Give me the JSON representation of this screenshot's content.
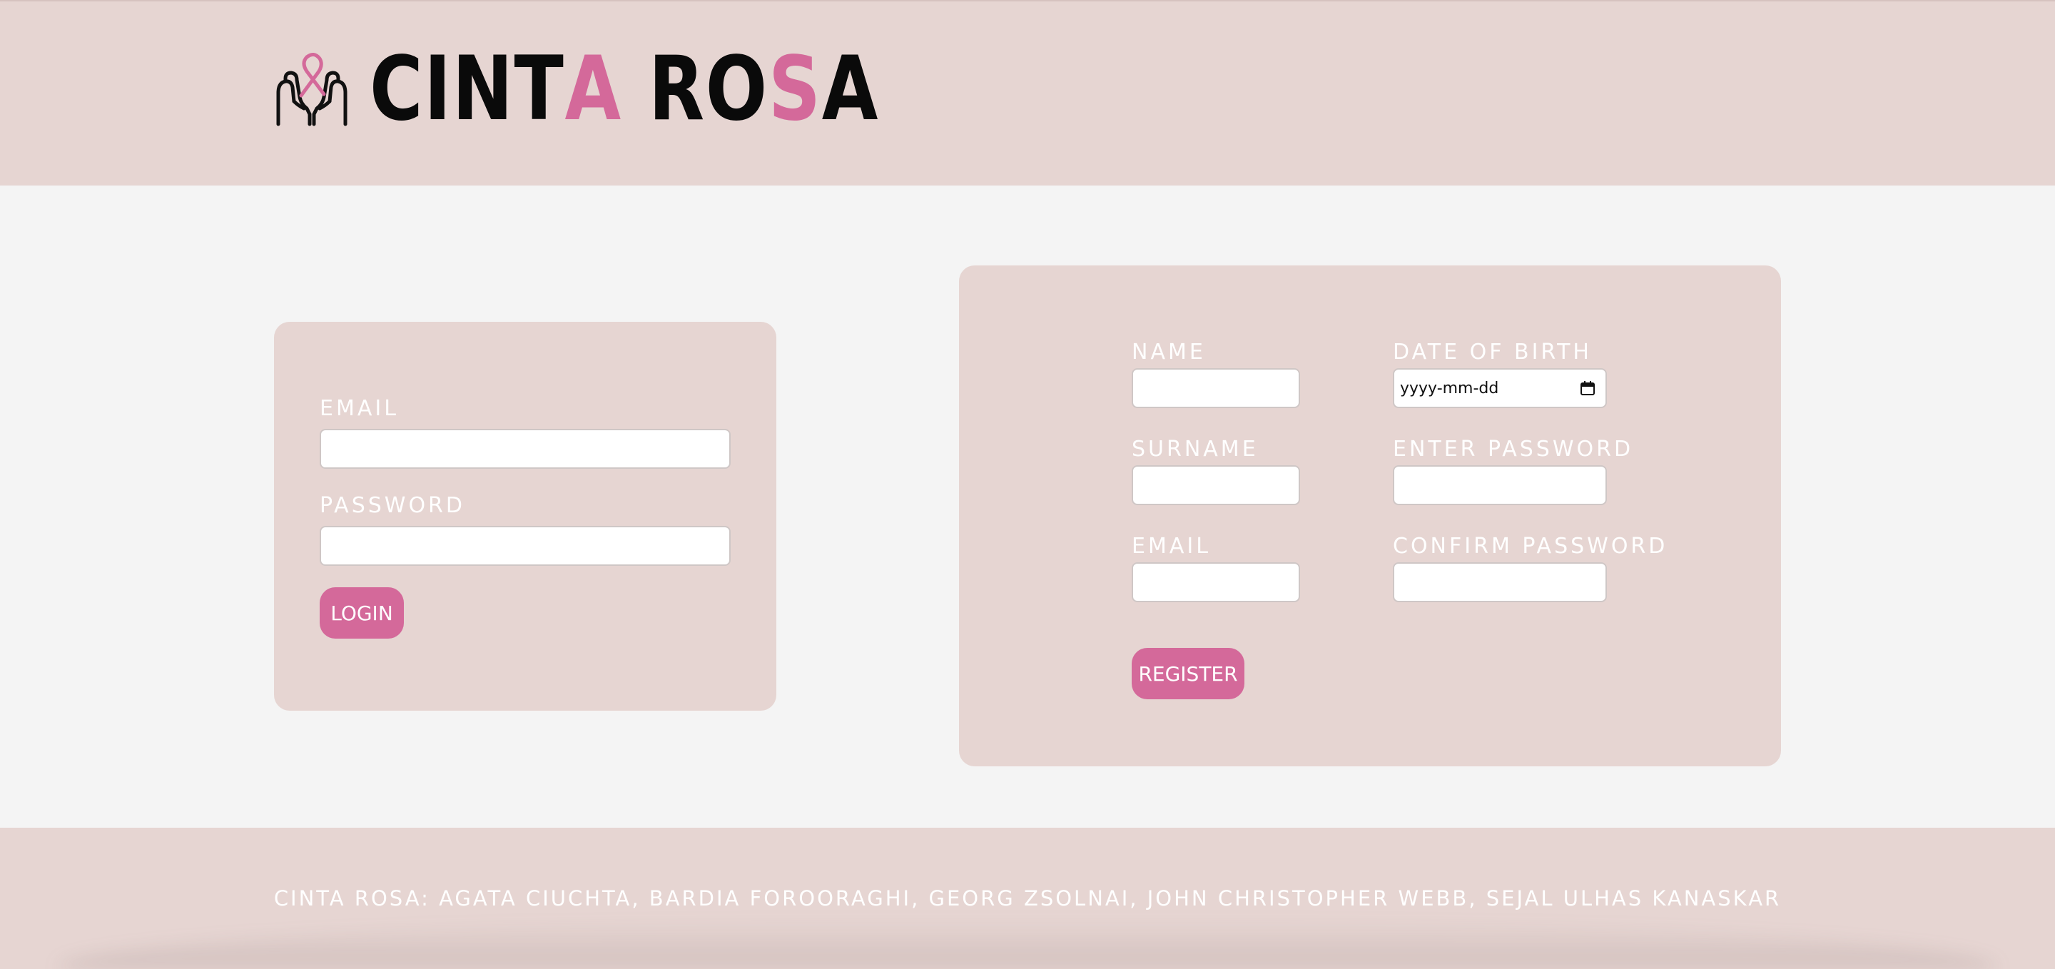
{
  "header": {
    "logo_icon": "hands-ribbon-icon",
    "brand": {
      "parts": [
        {
          "text": "CINT",
          "color": "#0a0a0a"
        },
        {
          "text": "A",
          "color": "#d4699a"
        },
        {
          "text": " RO",
          "color": "#0a0a0a"
        },
        {
          "text": "S",
          "color": "#d4699a"
        },
        {
          "text": "A",
          "color": "#0a0a0a"
        }
      ]
    }
  },
  "login": {
    "email_label": "EMAIL",
    "email_value": "",
    "password_label": "PASSWORD",
    "password_value": "",
    "submit_label": "LOGIN"
  },
  "register": {
    "name_label": "NAME",
    "name_value": "",
    "dob_label": "DATE OF BIRTH",
    "dob_placeholder": "yyyy-mm-dd",
    "surname_label": "SURNAME",
    "surname_value": "",
    "password_label": "ENTER PASSWORD",
    "password_value": "",
    "email_label": "EMAIL",
    "email_value": "",
    "confirm_label": "CONFIRM PASSWORD",
    "confirm_value": "",
    "submit_label": "REGISTER"
  },
  "footer": {
    "credits": "CINTA ROSA: AGATA CIUCHTA, BARDIA FOROORAGHI, GEORG ZSOLNAI, JOHN CHRISTOPHER WEBB, SEJAL ULHAS KANASKAR"
  },
  "colors": {
    "accent": "#d4699a",
    "panel": "#e6d5d2",
    "background": "#f4f4f4"
  }
}
